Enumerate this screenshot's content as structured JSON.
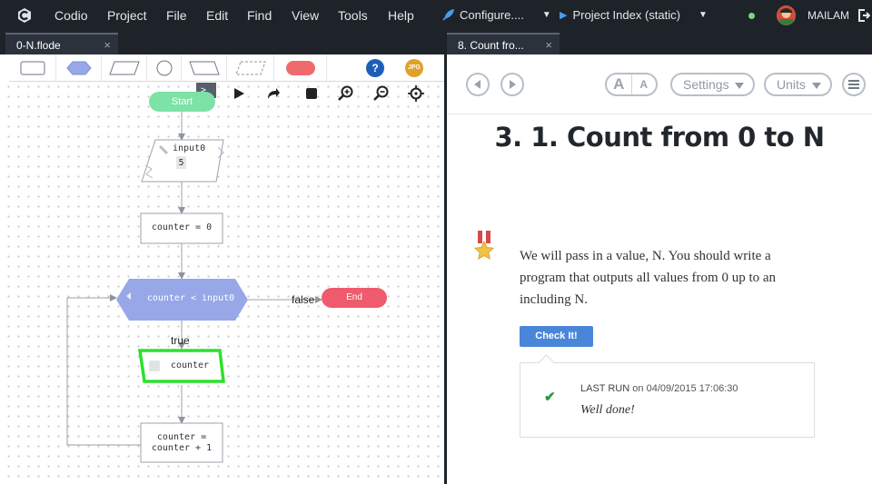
{
  "menubar": {
    "items": [
      "Codio",
      "Project",
      "File",
      "Edit",
      "Find",
      "View",
      "Tools",
      "Help"
    ],
    "configure_label": "Configure....",
    "preview_label": "Project Index (static)",
    "username": "MAILAM",
    "accent": "#1e2329"
  },
  "left_pane": {
    "tab_title": "0-N.flode",
    "tab_close": "×",
    "toolbar_badge": "JPG",
    "terminal_label": ">_",
    "help_label": "?",
    "flowchart": {
      "start": "Start",
      "input_name": "input0",
      "input_value": "5",
      "assign": "counter = 0",
      "decision": "counter < input0",
      "false_label": "false",
      "end": "End",
      "true_label": "true",
      "output": "counter",
      "increment_line1": "counter =",
      "increment_line2": "counter + 1",
      "colors": {
        "start": "#7de2a6",
        "decision": "#97a7e8",
        "end": "#ef5b6d",
        "output_border": "#2de02d"
      }
    }
  },
  "right_pane": {
    "tab_title": "8. Count fro...",
    "tab_close": "×",
    "settings_label": "Settings",
    "units_label": "Units",
    "font_large": "A",
    "font_small": "A",
    "heading": "3. 1. Count from 0 to N",
    "paragraph": "We will pass in a value, N. You should write a program that outputs all values from 0 up to an including N.",
    "check_button": "Check It!",
    "result": {
      "last_run": "LAST RUN",
      "on": "on",
      "timestamp": "04/09/2015 17:06:30",
      "message": "Well done!"
    }
  }
}
